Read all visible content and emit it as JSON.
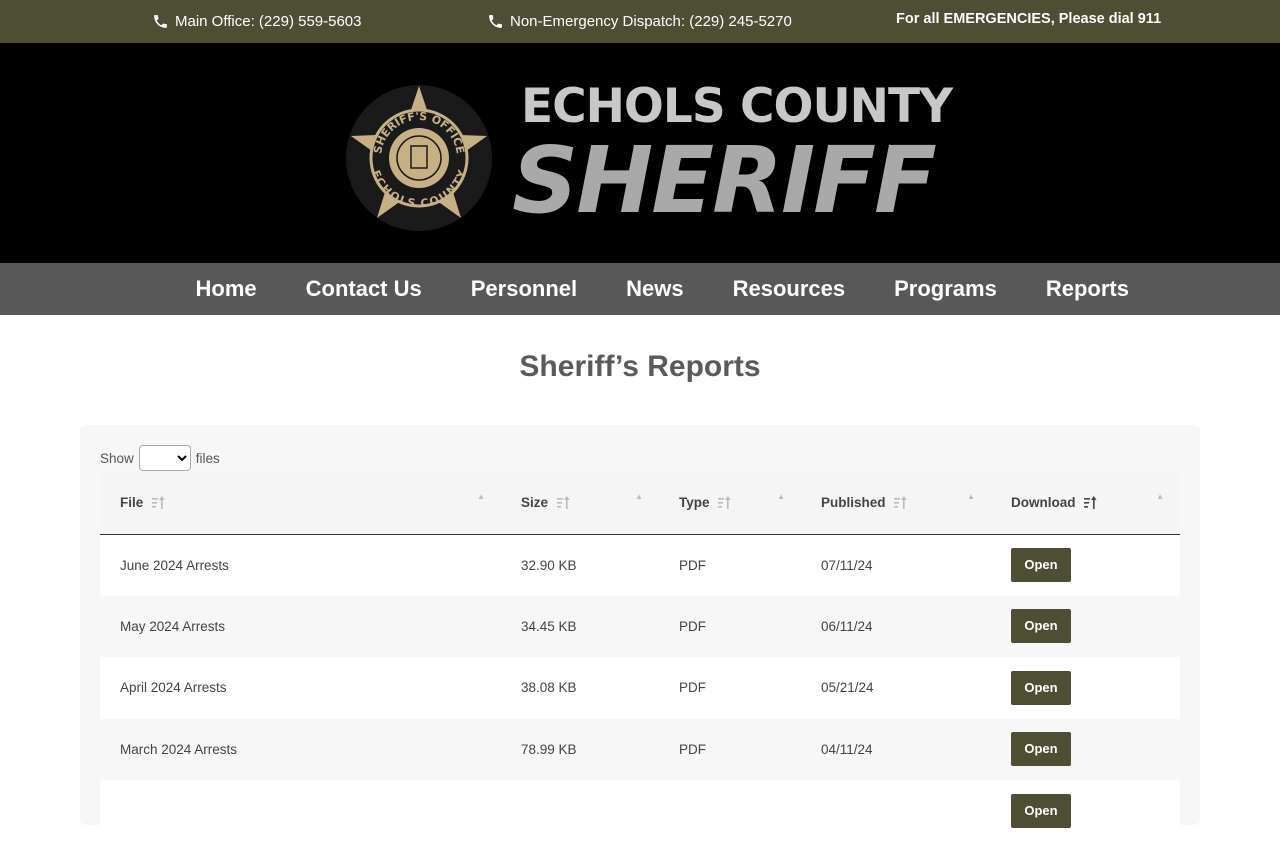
{
  "topbar": {
    "main_office": "Main Office: (229) 559-5603",
    "dispatch": "Non-Emergency Dispatch: (229) 245-5270",
    "emergency": "For all EMERGENCIES, Please dial 911",
    "phone_icon": "phone-icon"
  },
  "header": {
    "logo_line1": "ECHOLS COUNTY",
    "logo_line2": "SHERIFF",
    "badge_top": "SHERIFF'S OFFICE",
    "badge_bottom": "ECHOLS COUNTY"
  },
  "nav": {
    "items": [
      "Home",
      "Contact Us",
      "Personnel",
      "News",
      "Resources",
      "Programs",
      "Reports"
    ]
  },
  "page": {
    "title": "Sheriff’s Reports"
  },
  "reports": {
    "show_label": "Show",
    "files_label": "files",
    "columns": [
      "File",
      "Size",
      "Type",
      "Published",
      "Download"
    ],
    "rows": [
      {
        "file": "June 2024 Arrests",
        "size": "32.90 KB",
        "type": "PDF",
        "published": "07/11/24",
        "action": "Open"
      },
      {
        "file": "May 2024 Arrests",
        "size": "34.45 KB",
        "type": "PDF",
        "published": "06/11/24",
        "action": "Open"
      },
      {
        "file": "April 2024 Arrests",
        "size": "38.08 KB",
        "type": "PDF",
        "published": "05/21/24",
        "action": "Open"
      },
      {
        "file": "March 2024 Arrests",
        "size": "78.99 KB",
        "type": "PDF",
        "published": "04/11/24",
        "action": "Open"
      },
      {
        "file": "",
        "size": "",
        "type": "",
        "published": "",
        "action": "Open"
      }
    ]
  },
  "colors": {
    "topbar": "#4d4e34",
    "header": "#000000",
    "nav": "#585858",
    "button": "#4d4e34",
    "badge_gold": "#c6b084"
  }
}
